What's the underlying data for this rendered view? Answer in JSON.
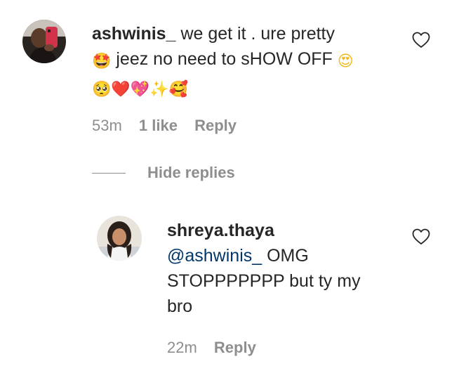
{
  "comment1": {
    "username": "ashwinis_",
    "text_line1": "we get it . ure pretty",
    "text_line2": "jeez no need to sHOW OFF",
    "emojis_line2_start": "🤩",
    "emojis_line2_end": "😍",
    "emojis_line3": [
      "🥺",
      "❤️",
      "💖",
      "✨",
      "🥰"
    ],
    "time": "53m",
    "likes": "1 like",
    "reply": "Reply"
  },
  "replies_toggle": {
    "label": "Hide replies"
  },
  "comment2": {
    "username": "shreya.thaya",
    "mention": "@ashwinis_",
    "text_line1": "OMG",
    "text_line2": "STOPPPPPPP but ty my",
    "text_line3": "bro",
    "time": "22m",
    "reply": "Reply"
  },
  "colors": {
    "text": "#262626",
    "muted": "#8e8e8e",
    "mention": "#00376b"
  },
  "icons": [
    "avatar",
    "heart-outline-icon"
  ]
}
